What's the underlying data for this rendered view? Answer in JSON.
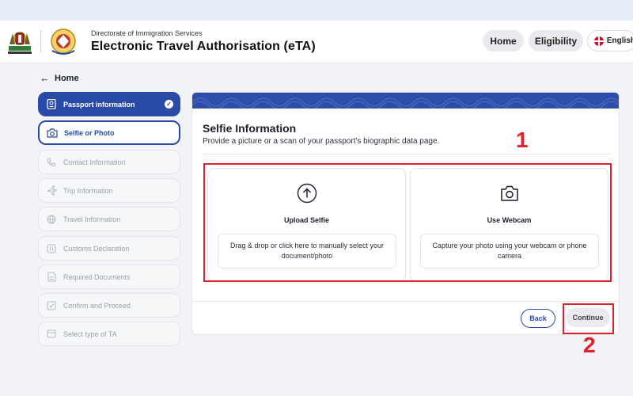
{
  "header": {
    "department": "Directorate of Immigration Services",
    "title": "Electronic Travel Authorisation (eTA)",
    "nav": {
      "home": "Home",
      "eligibility": "Eligibility",
      "language": "English"
    }
  },
  "back_link": "Home",
  "steps": [
    {
      "label": "Passport information",
      "state": "completed",
      "icon": "passport-icon"
    },
    {
      "label": "Selfie or Photo",
      "state": "current",
      "icon": "camera-icon"
    },
    {
      "label": "Contact Information",
      "state": "disabled",
      "icon": "phone-icon"
    },
    {
      "label": "Trip Information",
      "state": "disabled",
      "icon": "plane-icon"
    },
    {
      "label": "Travel Information",
      "state": "disabled",
      "icon": "globe-icon"
    },
    {
      "label": "Customs Declaration",
      "state": "disabled",
      "icon": "customs-icon"
    },
    {
      "label": "Required Documents",
      "state": "disabled",
      "icon": "document-icon"
    },
    {
      "label": "Confirm and Proceed",
      "state": "disabled",
      "icon": "checkbox-icon"
    },
    {
      "label": "Select type of TA",
      "state": "disabled",
      "icon": "card-icon"
    }
  ],
  "card": {
    "title": "Selfie Information",
    "subtitle": "Provide a picture or a scan of your passport's biographic data page.",
    "upload": {
      "title": "Upload Selfie",
      "description": "Drag & drop or click here to manually select your document/photo"
    },
    "webcam": {
      "title": "Use Webcam",
      "description": "Capture your photo using your webcam or phone camera"
    },
    "back_label": "Back",
    "continue_label": "Continue"
  },
  "annotations": {
    "one": "1",
    "two": "2"
  },
  "colors": {
    "primary": "#2a4aa8",
    "annotation": "#e0202a",
    "banner": "#2e4fa9"
  }
}
